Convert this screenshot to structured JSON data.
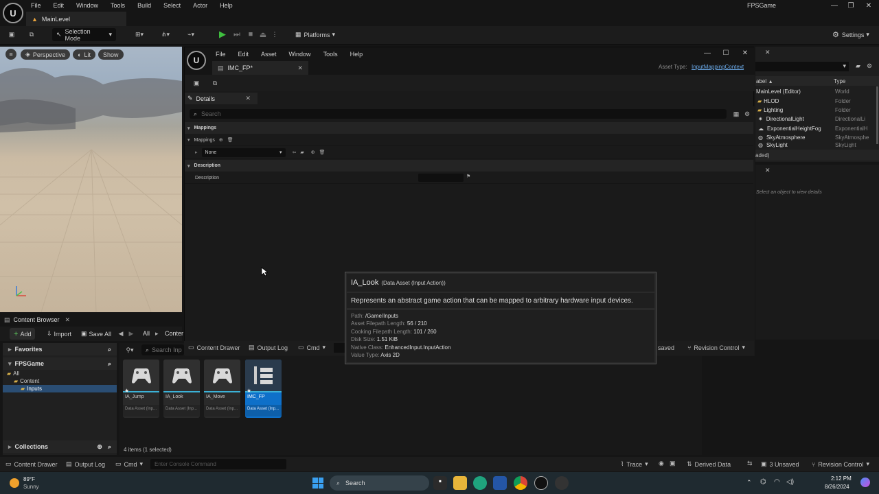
{
  "main_menu": {
    "items": [
      "File",
      "Edit",
      "Window",
      "Tools",
      "Build",
      "Select",
      "Actor",
      "Help"
    ],
    "level_tab": "MainLevel",
    "project_name": "FPSGame"
  },
  "main_toolbar": {
    "selection_mode": "Selection Mode",
    "platforms": "Platforms",
    "settings": "Settings"
  },
  "viewport": {
    "perspective": "Perspective",
    "lit": "Lit",
    "show": "Show"
  },
  "content_browser": {
    "tab": "Content Browser",
    "add": "Add",
    "import": "Import",
    "save_all": "Save All",
    "breadcrumb_all": "All",
    "breadcrumb_content": "Conter",
    "favorites": "Favorites",
    "project": "FPSGame",
    "tree": [
      "All",
      "Content",
      "Inputs"
    ],
    "collections": "Collections",
    "search_placeholder": "Search Inp",
    "assets": [
      {
        "name": "IA_Jump",
        "type": "Data Asset (Inp..."
      },
      {
        "name": "IA_Look",
        "type": "Data Asset (Inp..."
      },
      {
        "name": "IA_Move",
        "type": "Data Asset (Inp..."
      },
      {
        "name": "IMC_FP",
        "type": "Data Asset (Inp..."
      }
    ],
    "status": "4 items (1 selected)"
  },
  "editor": {
    "menu": [
      "File",
      "Edit",
      "Asset",
      "Window",
      "Tools",
      "Help"
    ],
    "tab": "IMC_FP*",
    "asset_type_label": "Asset Type:",
    "asset_type_value": "InputMappingContext",
    "details_tab": "Details",
    "search_placeholder": "Search",
    "cat_mappings": "Mappings",
    "prop_mappings": "Mappings",
    "none_value": "None",
    "cat_description": "Description",
    "prop_description": "Description",
    "bottom": {
      "content_drawer": "Content Drawer",
      "output_log": "Output Log",
      "cmd": "Cmd",
      "unsaved": "saved",
      "revision_control": "Revision Control"
    }
  },
  "outliner": {
    "col_label": "abel",
    "col_type": "Type",
    "rows": [
      {
        "label": "MainLevel (Editor)",
        "type": "World"
      },
      {
        "label": "HLOD",
        "type": "Folder"
      },
      {
        "label": "Lighting",
        "type": "Folder"
      },
      {
        "label": "DirectionalLight",
        "type": "DirectionalLi"
      },
      {
        "label": "ExponentialHeightFog",
        "type": "ExponentialH"
      },
      {
        "label": "SkyAtmosphere",
        "type": "SkyAtmosphe"
      },
      {
        "label": "SkyLight",
        "type": "SkyLight"
      }
    ],
    "footer": "aded)"
  },
  "details_right": {
    "placeholder": "Select an object to view details"
  },
  "tooltip": {
    "title": "IA_Look",
    "subtitle": "(Data Asset (Input Action))",
    "description": "Represents an abstract game action that can be mapped to arbitrary hardware input devices.",
    "props": [
      {
        "k": "Path:",
        "v": "/Game/Inputs"
      },
      {
        "k": "Asset Filepath Length:",
        "v": "56 / 210"
      },
      {
        "k": "Cooking Filepath Length:",
        "v": "101 / 260"
      },
      {
        "k": "Disk Size:",
        "v": "1.51 KiB"
      },
      {
        "k": "Native Class:",
        "v": "EnhancedInput.InputAction"
      },
      {
        "k": "Value Type:",
        "v": "Axis 2D"
      }
    ]
  },
  "statusbar": {
    "content_drawer": "Content Drawer",
    "output_log": "Output Log",
    "cmd": "Cmd",
    "console_placeholder": "Enter Console Command",
    "trace": "Trace",
    "derived_data": "Derived Data",
    "unsaved": "3 Unsaved",
    "revision_control": "Revision Control"
  },
  "taskbar": {
    "weather_temp": "89°F",
    "weather_desc": "Sunny",
    "search": "Search",
    "time": "2:12 PM",
    "date": "8/26/2024"
  }
}
